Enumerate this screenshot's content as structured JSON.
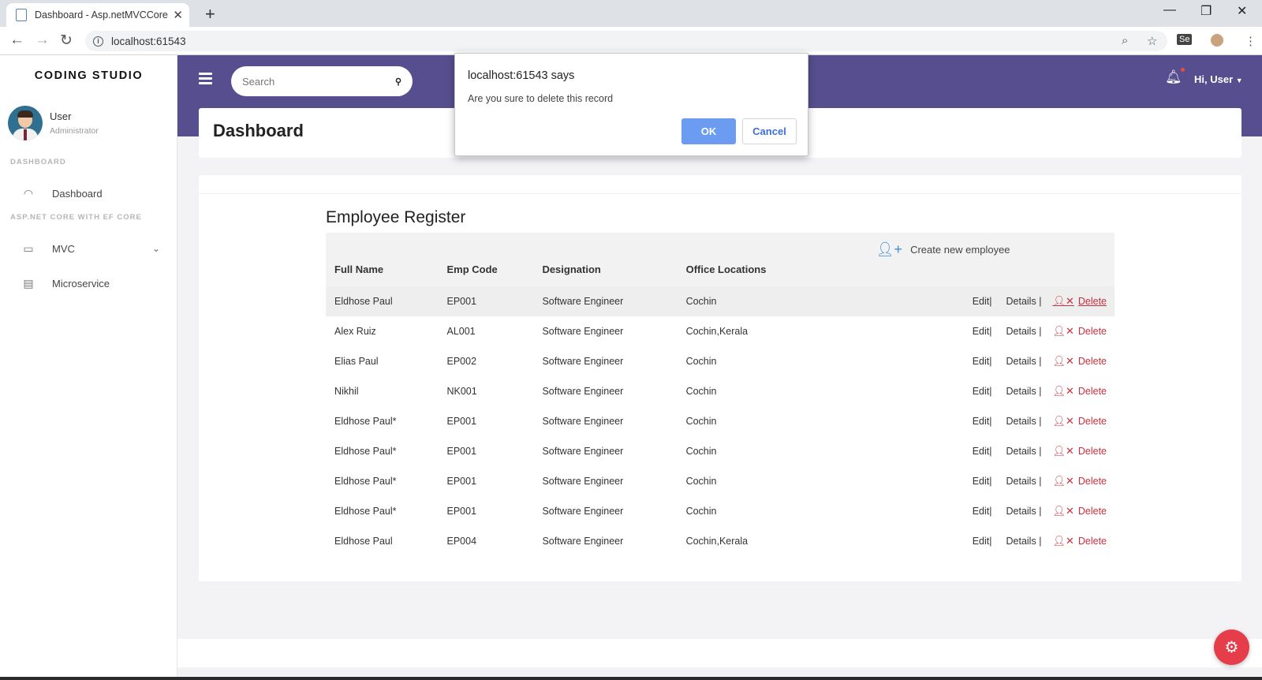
{
  "browser": {
    "tab_title": "Dashboard - Asp.netMVCCoreWi",
    "url": "localhost:61543"
  },
  "sidebar": {
    "brand": "CODING STUDIO",
    "user_name": "User",
    "user_role": "Administrator",
    "section_dashboard": "DASHBOARD",
    "section_aspnet": "ASP.NET CORE WITH EF CORE",
    "items": [
      {
        "label": "Dashboard",
        "icon": "gauge-icon"
      },
      {
        "label": "MVC",
        "icon": "window-icon"
      },
      {
        "label": "Microservice",
        "icon": "clipboard-icon"
      }
    ]
  },
  "topbar": {
    "search_placeholder": "Search",
    "greeting": "Hi, User"
  },
  "page_title": "Dashboard",
  "register": {
    "title": "Employee Register",
    "columns": [
      "Full Name",
      "Emp Code",
      "Designation",
      "Office Locations"
    ],
    "create_label": "Create new employee",
    "action_labels": {
      "edit": "Edit",
      "details": "Details",
      "delete": "Delete",
      "sep": "|"
    },
    "rows": [
      [
        "Eldhose Paul",
        "EP001",
        "Software Engineer",
        "Cochin"
      ],
      [
        "Alex Ruiz",
        "AL001",
        "Software Engineer",
        "Cochin,Kerala"
      ],
      [
        "Elias Paul",
        "EP002",
        "Software Engineer",
        "Cochin"
      ],
      [
        "Nikhil",
        "NK001",
        "Software Engineer",
        "Cochin"
      ],
      [
        "Eldhose Paul*",
        "EP001",
        "Software Engineer",
        "Cochin"
      ],
      [
        "Eldhose Paul*",
        "EP001",
        "Software Engineer",
        "Cochin"
      ],
      [
        "Eldhose Paul*",
        "EP001",
        "Software Engineer",
        "Cochin"
      ],
      [
        "Eldhose Paul*",
        "EP001",
        "Software Engineer",
        "Cochin"
      ],
      [
        "Eldhose Paul",
        "EP004",
        "Software Engineer",
        "Cochin,Kerala"
      ]
    ]
  },
  "dialog": {
    "title": "localhost:61543 says",
    "message": "Are you sure to delete this record",
    "ok_label": "OK",
    "cancel_label": "Cancel"
  },
  "colors": {
    "topbar": "#574e8f",
    "delete": "#c8303e",
    "accent_blue": "#3d8fd8",
    "fab": "#e53d4a"
  }
}
